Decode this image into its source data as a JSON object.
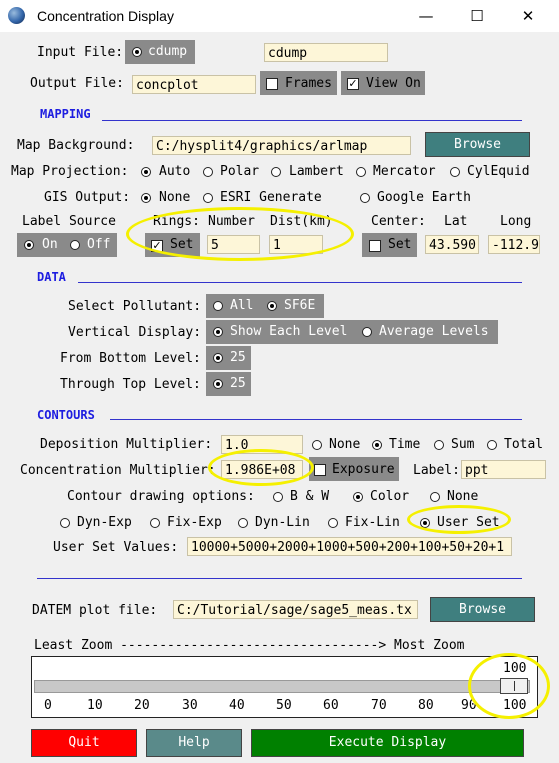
{
  "window": {
    "title": "Concentration Display",
    "minimize": "—",
    "maximize": "☐",
    "close": "✕"
  },
  "files": {
    "input_label": "Input File:",
    "input_radio": "cdump",
    "input_value": "cdump",
    "output_label": "Output File:",
    "output_value": "concplot",
    "frames_label": "Frames",
    "frames_checked": false,
    "viewon_label": "View On",
    "viewon_checked": true
  },
  "mapping": {
    "section": "MAPPING",
    "background_label": "Map Background:",
    "background_value": "C:/hysplit4/graphics/arlmap",
    "browse": "Browse",
    "projection_label": "Map Projection:",
    "projection_options": [
      "Auto",
      "Polar",
      "Lambert",
      "Mercator",
      "CylEquid"
    ],
    "projection_selected": "Auto",
    "gis_label": "GIS Output:",
    "gis_options": [
      "None",
      "ESRI Generate",
      "Google Earth"
    ],
    "gis_selected": "None",
    "label_source": "Label Source",
    "label_on": "On",
    "label_off": "Off",
    "label_selected": "On",
    "rings": "Rings:",
    "rings_set": "Set",
    "rings_set_checked": true,
    "number_label": "Number",
    "number_value": "5",
    "dist_label": "Dist(km)",
    "dist_value": "1",
    "center_label": "Center:",
    "center_set": "Set",
    "center_set_checked": false,
    "lat_label": "Lat",
    "lat_value": "43.590",
    "long_label": "Long",
    "long_value": "-112.9"
  },
  "data": {
    "section": "DATA",
    "pollutant_label": "Select Pollutant:",
    "pollutant_all": "All",
    "pollutant_sf6e": "SF6E",
    "pollutant_selected": "SF6E",
    "vertical_label": "Vertical Display:",
    "vertical_each": "Show Each Level",
    "vertical_avg": "Average Levels",
    "vertical_selected": "Show Each Level",
    "bottom_label": "From Bottom Level:",
    "bottom_value": "25",
    "top_label": "Through Top Level:",
    "top_value": "25"
  },
  "contours": {
    "section": "CONTOURS",
    "dep_label": "Deposition Multiplier:",
    "dep_value": "1.0",
    "dep_options": [
      "None",
      "Time",
      "Sum",
      "Total"
    ],
    "dep_selected": "Time",
    "conc_label": "Concentration Multiplier:",
    "conc_value": "1.986E+08",
    "exposure_label": "Exposure",
    "exposure_checked": false,
    "label_label": "Label:",
    "label_value": "ppt",
    "drawing_label": "Contour drawing options:",
    "drawing_options": [
      "B & W",
      "Color",
      "None"
    ],
    "drawing_selected": "Color",
    "type_options": [
      "Dyn-Exp",
      "Fix-Exp",
      "Dyn-Lin",
      "Fix-Lin",
      "User Set"
    ],
    "type_selected": "User Set",
    "userset_label": "User Set Values:",
    "userset_value": "10000+5000+2000+1000+500+200+100+50+20+1"
  },
  "datem": {
    "label": "DATEM plot file:",
    "value": "C:/Tutorial/sage/sage5_meas.tx",
    "browse": "Browse"
  },
  "zoom": {
    "caption": "Least Zoom ---------------------------------> Most Zoom",
    "value": "100",
    "level": 100,
    "min": 0,
    "max": 100,
    "ticks": [
      "0",
      "10",
      "20",
      "30",
      "40",
      "50",
      "60",
      "70",
      "80",
      "90",
      "100"
    ]
  },
  "buttons": {
    "quit": "Quit",
    "help": "Help",
    "execute": "Execute Display"
  },
  "colors": {
    "section": "#1d1de0",
    "field": "#fdf6d8",
    "browse": "#3f7f7f",
    "quit": "#ff0000",
    "help": "#5a8a8a",
    "execute": "#008000",
    "highlight": "#f5f000"
  }
}
